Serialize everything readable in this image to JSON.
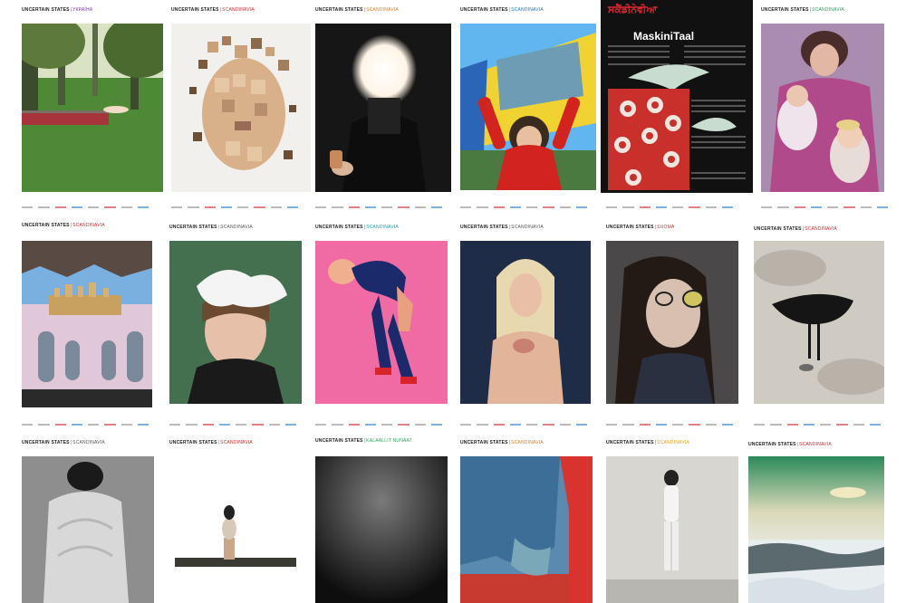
{
  "page": {
    "background": "#ffffff"
  },
  "covers": [
    {
      "series": "UNCERTAIN STATES",
      "region": "УКРАЇНА",
      "region_color": "#8a2be2",
      "subject": "field-with-reclining-figure"
    },
    {
      "series": "UNCERTAIN STATES",
      "region": "SCANDINAVIA",
      "region_color": "#d9272e",
      "subject": "fragmented-portrait"
    },
    {
      "series": "UNCERTAIN STATES",
      "region": "SCANDINAVIA",
      "region_color": "#e07b20",
      "subject": "glowing-face-with-phone"
    },
    {
      "series": "UNCERTAIN STATES",
      "region": "SCANDINAVIA",
      "region_color": "#1a73c7",
      "subject": "child-on-vehicle"
    },
    {
      "series": "",
      "region": "ਸਕੈਂਡੀਨੇਵੀਆ",
      "region_color": "#d9272e",
      "subject": "newspaper-collage",
      "masthead": "MaskiniTaal"
    },
    {
      "series": "UNCERTAIN STATES",
      "region": "SCANDINAVIA",
      "region_color": "#2aa55a",
      "subject": "mother-with-children"
    },
    {
      "series": "UNCERTAIN STATES",
      "region": "SCANDINAVIA",
      "region_color": "#d9272e",
      "subject": "surreal-landscape"
    },
    {
      "series": "UNCERTAIN STATES",
      "region": "SCANDINAVIA",
      "region_color": "#555555",
      "subject": "woman-with-cloud"
    },
    {
      "series": "UNCERTAIN STATES",
      "region": "SCANDINAVIA",
      "region_color": "#1a9fb0",
      "subject": "figure-on-pink"
    },
    {
      "series": "UNCERTAIN STATES",
      "region": "SCANDINAVIA",
      "region_color": "#555555",
      "subject": "youth-portrait"
    },
    {
      "series": "UNCERTAIN STATES",
      "region": "SUOMA",
      "region_color": "#d9272e",
      "subject": "woman-with-glasses"
    },
    {
      "series": "UNCERTAIN STATES",
      "region": "SCANDINAVIA",
      "region_color": "#d9272e",
      "subject": "bird-on-paper"
    },
    {
      "series": "UNCERTAIN STATES",
      "region": "SCANDINAVIA",
      "region_color": "#555555",
      "subject": "hunched-figure"
    },
    {
      "series": "UNCERTAIN STATES",
      "region": "SCANDINAVIA",
      "region_color": "#d9272e",
      "subject": "small-sculpture"
    },
    {
      "series": "UNCERTAIN STATES",
      "region": "KALAALLIT NUNAAT",
      "region_color": "#2aa55a",
      "subject": "dark-gradient"
    },
    {
      "series": "UNCERTAIN STATES",
      "region": "SCANDINAVIA",
      "region_color": "#e07b20",
      "subject": "curtain-interior"
    },
    {
      "series": "UNCERTAIN STATES",
      "region": "SCANDINAVIA",
      "region_color": "#e0a020",
      "subject": "fencer-in-room"
    },
    {
      "series": "UNCERTAIN STATES",
      "region": "SCANDINAVIA",
      "region_color": "#d9272e",
      "subject": "snowy-landscape"
    }
  ]
}
